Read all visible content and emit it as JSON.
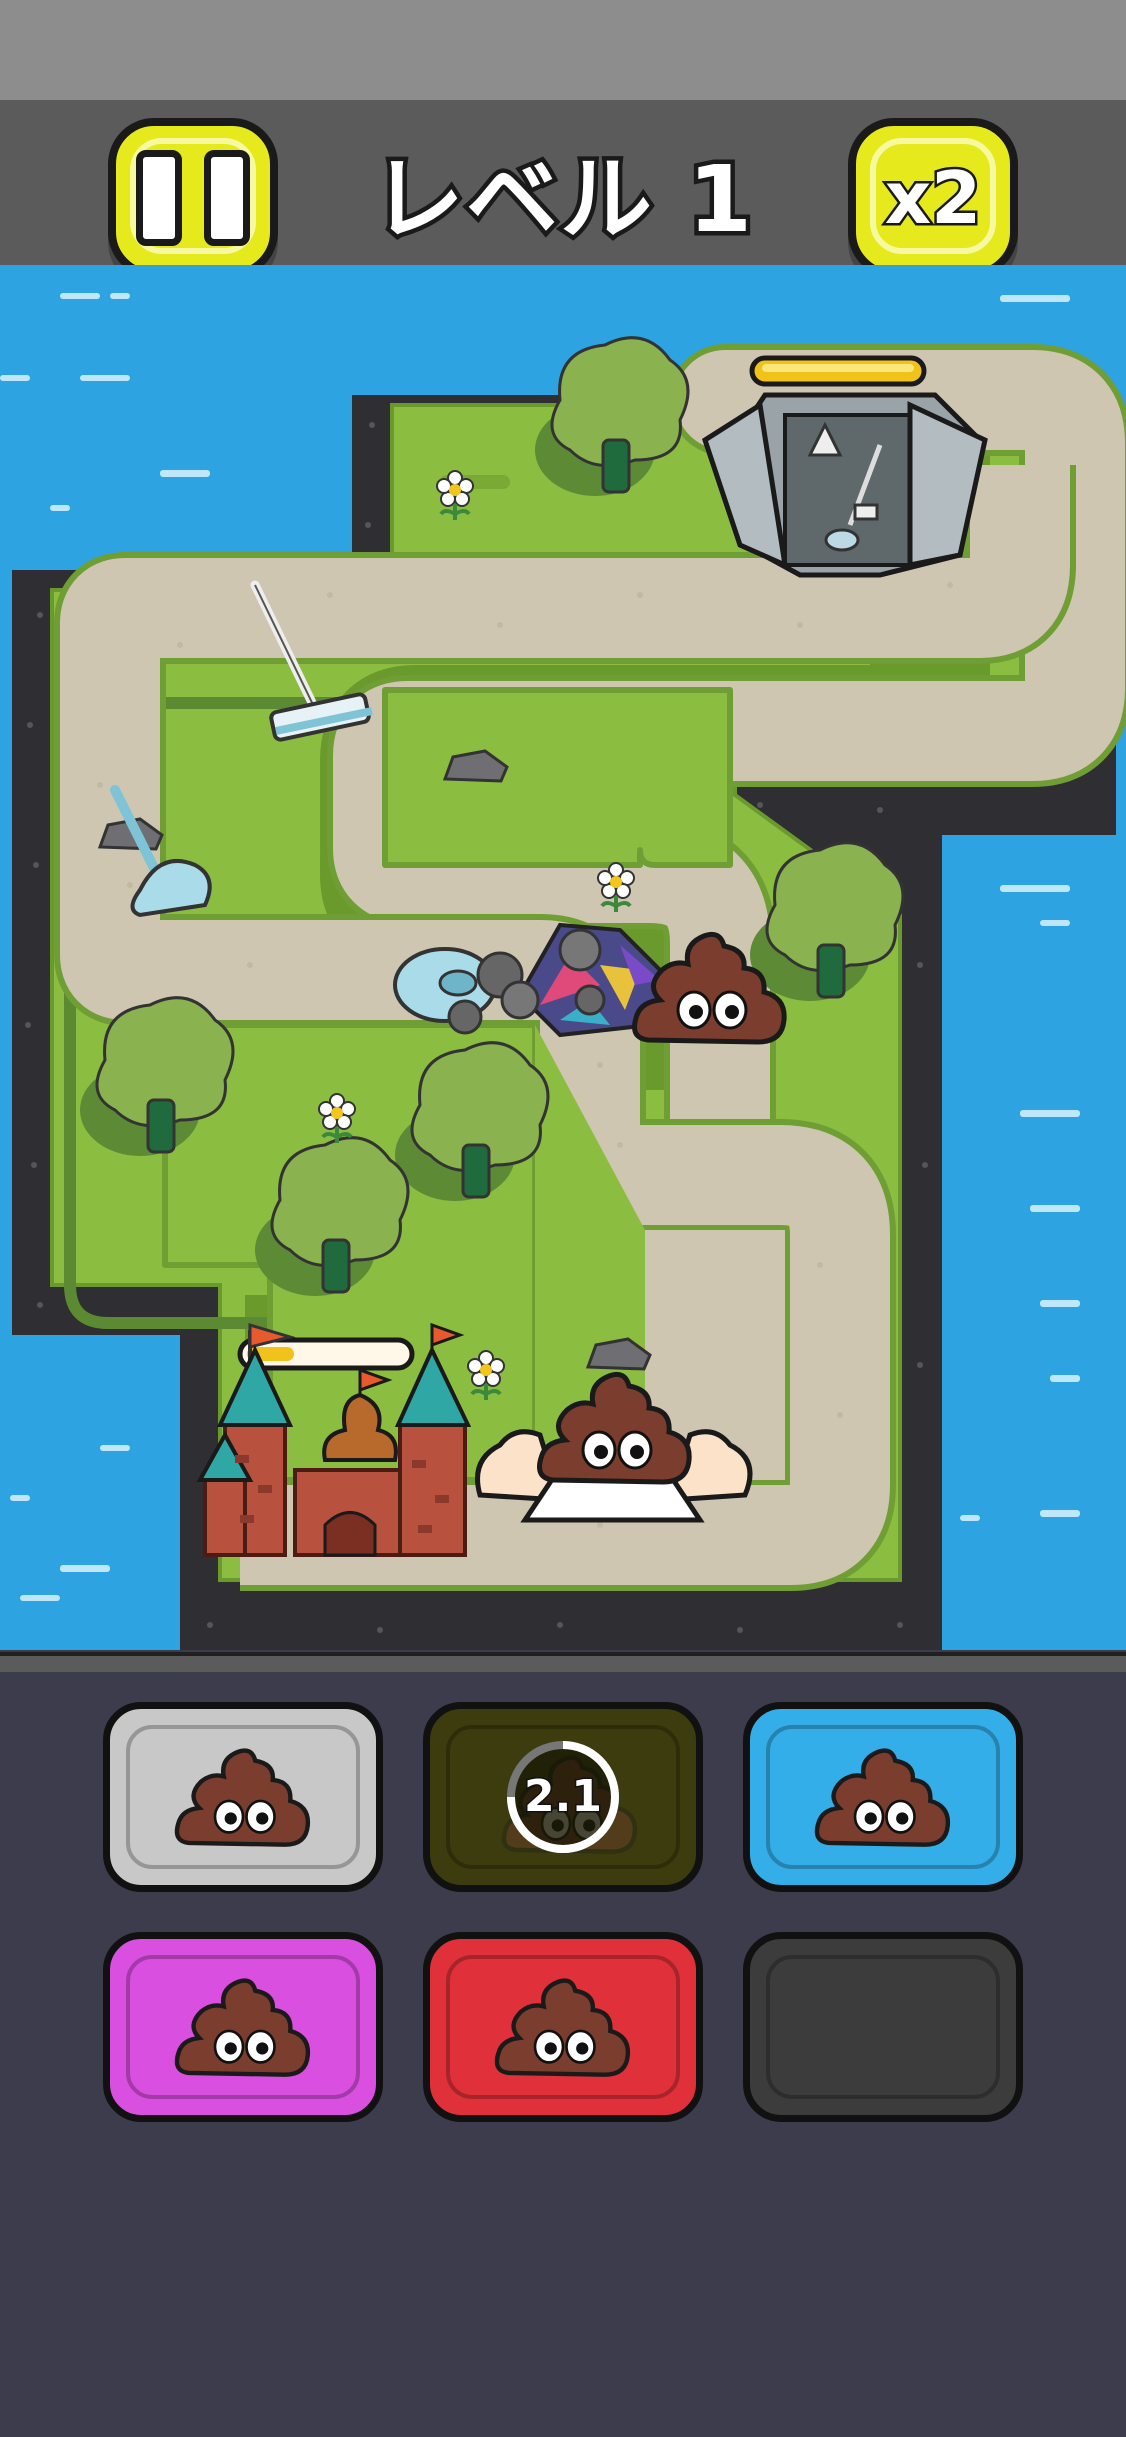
{
  "header": {
    "level_title": "レベル 1",
    "speed_label": "x2",
    "pause_icon": "pause-icon"
  },
  "map": {
    "base_health": 0.3,
    "enemy_base_health": 1.0
  },
  "unit_slots": [
    {
      "color": "#c8c8c8",
      "icon": "poop-icon",
      "state": "ready"
    },
    {
      "color": "#3d3c0e",
      "icon": "poop-icon",
      "state": "cooldown",
      "cooldown_text": "2.1"
    },
    {
      "color": "#34aee8",
      "icon": "poop-icon",
      "state": "ready"
    },
    {
      "color": "#d94fe0",
      "icon": "poop-icon",
      "state": "ready"
    },
    {
      "color": "#e0313a",
      "icon": "poop-icon",
      "state": "ready"
    },
    {
      "color": "#3c3c3c",
      "icon": "empty-slot",
      "state": "empty"
    }
  ],
  "colors": {
    "water": "#2ea3e2",
    "grass": "#8bbd41",
    "road": "#cfc6b2",
    "button": "#e6ea1c"
  }
}
